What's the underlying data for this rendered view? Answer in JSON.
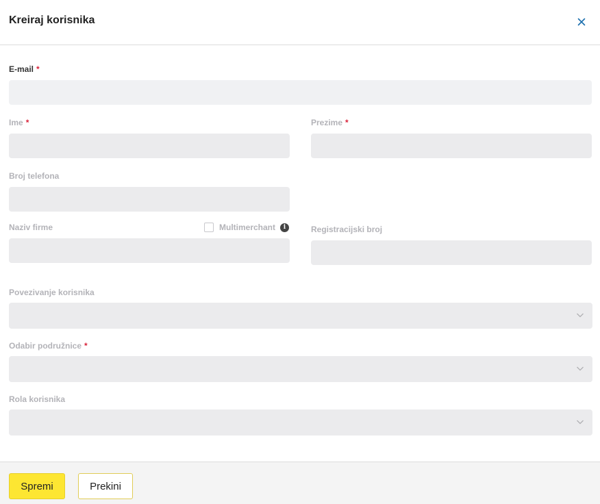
{
  "dialog": {
    "title": "Kreiraj korisnika",
    "close_icon": "close-icon"
  },
  "form": {
    "email": {
      "label": "E-mail",
      "required": "*",
      "value": ""
    },
    "first_name": {
      "label": "Ime",
      "required": "*",
      "value": ""
    },
    "last_name": {
      "label": "Prezime",
      "required": "*",
      "value": ""
    },
    "phone": {
      "label": "Broj telefona",
      "value": ""
    },
    "company": {
      "label": "Naziv firme",
      "value": ""
    },
    "multimerchant": {
      "label": "Multimerchant",
      "checked": false,
      "info_icon": "info-icon"
    },
    "registration": {
      "label": "Registracijski broj",
      "value": ""
    },
    "link_user": {
      "label": "Povezivanje korisnika",
      "value": ""
    },
    "branch": {
      "label": "Odabir podružnice",
      "required": "*",
      "value": ""
    },
    "role": {
      "label": "Rola korisnika",
      "value": ""
    }
  },
  "footer": {
    "save_label": "Spremi",
    "cancel_label": "Prekini"
  },
  "colors": {
    "primary_button": "#fde632",
    "required": "#d9233a",
    "close_icon": "#1b6fae"
  }
}
